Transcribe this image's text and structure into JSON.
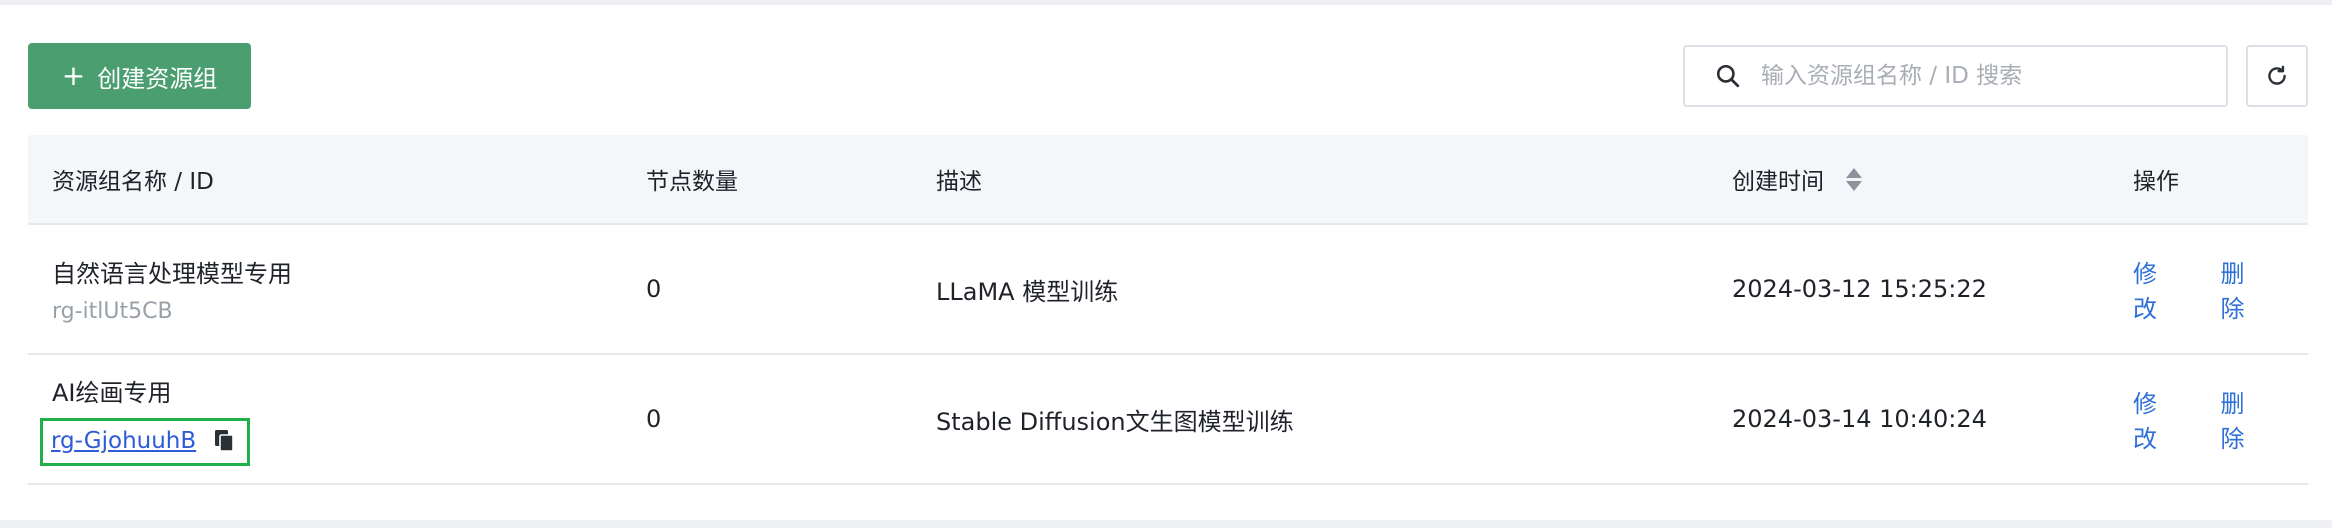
{
  "toolbar": {
    "create_label": "创建资源组",
    "create_plus": "+",
    "search_placeholder": "输入资源组名称 / ID 搜索",
    "search_value": ""
  },
  "table": {
    "columns": {
      "name": "资源组名称 / ID",
      "nodes": "节点数量",
      "desc": "描述",
      "time": "创建时间",
      "ops": "操作"
    },
    "rows": [
      {
        "name": "自然语言处理模型专用",
        "id": "rg-itlUt5CB",
        "nodes": "0",
        "desc": "LLaMA 模型训练",
        "time": "2024-03-12 15:25:22",
        "edit": "修改",
        "delete": "删除"
      },
      {
        "name": "AI绘画专用",
        "id": "rg-GjohuuhB",
        "nodes": "0",
        "desc": "Stable Diffusion文生图模型训练",
        "time": "2024-03-14 10:40:24",
        "edit": "修改",
        "delete": "删除"
      }
    ]
  },
  "icons": {
    "search": "search-icon",
    "refresh": "refresh-icon",
    "sort": "sort-icon",
    "copy": "copy-icon"
  },
  "colors": {
    "primary_button": "#4a9e6f",
    "link": "#2e6fd8",
    "highlight_border": "#1fb04c"
  }
}
